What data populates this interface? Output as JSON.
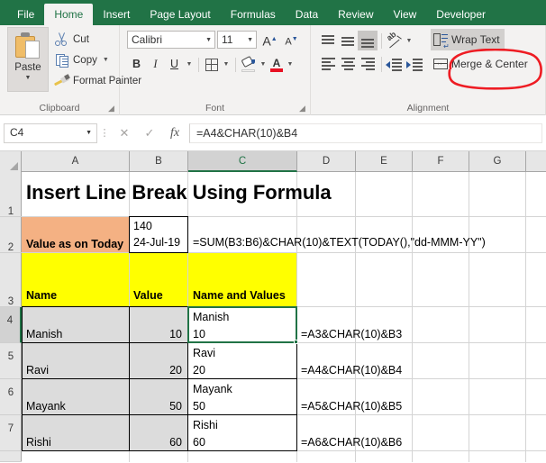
{
  "ribbon_tabs": [
    {
      "label": "File",
      "active": false
    },
    {
      "label": "Home",
      "active": true
    },
    {
      "label": "Insert",
      "active": false
    },
    {
      "label": "Page Layout",
      "active": false
    },
    {
      "label": "Formulas",
      "active": false
    },
    {
      "label": "Data",
      "active": false
    },
    {
      "label": "Review",
      "active": false
    },
    {
      "label": "View",
      "active": false
    },
    {
      "label": "Developer",
      "active": false
    }
  ],
  "clipboard": {
    "group_label": "Clipboard",
    "paste_label": "Paste",
    "cut_label": "Cut",
    "copy_label": "Copy",
    "format_painter_label": "Format Painter"
  },
  "font": {
    "group_label": "Font",
    "font_name": "Calibri",
    "font_size": "11",
    "bold_label": "B",
    "italic_label": "I",
    "underline_label": "U",
    "grow_font_label": "A",
    "shrink_font_label": "A",
    "font_color_label": "A",
    "font_color_hex": "#e81123"
  },
  "alignment": {
    "group_label": "Alignment",
    "wrap_text_label": "Wrap Text",
    "merge_center_label": "Merge & Center",
    "wrap_text_active": true,
    "bottom_align_active": true
  },
  "annotation": {
    "shape": "hand-drawn-ellipse",
    "color_hex": "#ee1c23",
    "target": "Wrap Text"
  },
  "formula_bar": {
    "name_box_value": "C4",
    "cancel_label": "✕",
    "enter_label": "✓",
    "function_label": "fx",
    "formula_value": "=A4&CHAR(10)&B4"
  },
  "grid": {
    "column_headers": [
      "A",
      "B",
      "C",
      "D",
      "E",
      "F",
      "G"
    ],
    "selected_column": "C",
    "row_headers": [
      "1",
      "2",
      "3",
      "4",
      "5",
      "6",
      "7"
    ],
    "selected_row": "4",
    "active_cell": "C4",
    "cells": {
      "A1": "Insert Line Break Using Formula",
      "A2": "Value as on Today",
      "B2_line1": "140",
      "B2_line2": "24-Jul-19",
      "C2": "=SUM(B3:B6)&CHAR(10)&TEXT(TODAY(),\"dd-MMM-YY\")",
      "A3": "Name",
      "B3": "Value",
      "C3": "Name and Values",
      "A4": "Manish",
      "B4": "10",
      "C4_line1": "Manish",
      "C4_line2": "10",
      "D4": "=A3&CHAR(10)&B3",
      "A5": "Ravi",
      "B5": "20",
      "C5_line1": "Ravi",
      "C5_line2": "20",
      "D5": "=A4&CHAR(10)&B4",
      "A6": "Mayank",
      "B6": "50",
      "C6_line1": "Mayank",
      "C6_line2": "50",
      "D6": "=A5&CHAR(10)&B5",
      "A7": "Rishi",
      "B7": "60",
      "C7_line1": "Rishi",
      "C7_line2": "60",
      "D7": "=A6&CHAR(10)&B6"
    },
    "colors": {
      "orange_header": "#f4b183",
      "yellow_header": "#ffff00",
      "selection_green": "#217346",
      "row_shade": "#dcdcdc"
    }
  }
}
